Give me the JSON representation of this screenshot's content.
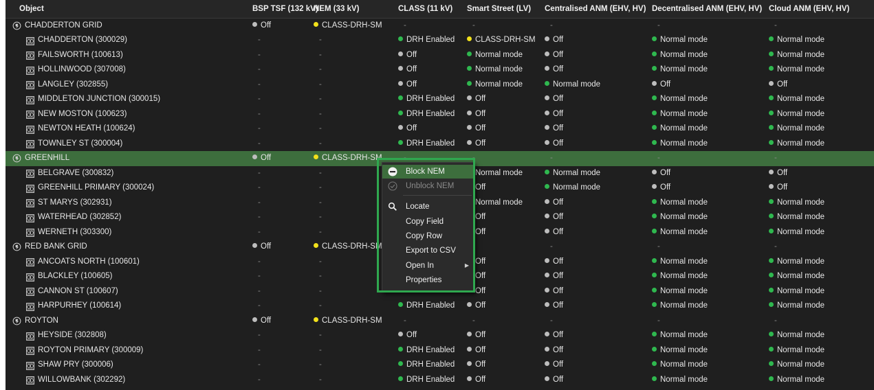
{
  "columns": [
    {
      "key": "object",
      "label": "Object"
    },
    {
      "key": "bsp",
      "label": "BSP TSF (132 kV)"
    },
    {
      "key": "nem",
      "label": "NEM (33 kV)"
    },
    {
      "key": "class11",
      "label": "CLASS (11 kV)"
    },
    {
      "key": "smart",
      "label": "Smart Street (LV)"
    },
    {
      "key": "central",
      "label": "Centralised ANM (EHV, HV)"
    },
    {
      "key": "decentral",
      "label": "Decentralised ANM (EHV, HV)"
    },
    {
      "key": "cloud",
      "label": "Cloud ANM (EHV, HV)"
    }
  ],
  "colors": {
    "green": "#2fb84f",
    "grey": "#bdbdbd",
    "yellow": "#f2e11b"
  },
  "rows": [
    {
      "name": "CHADDERTON GRID",
      "type": "grid",
      "cells": [
        {
          "c": "grey",
          "t": "Off"
        },
        {
          "c": "yellow",
          "t": "CLASS-DRH-SM"
        },
        {
          "t": "-"
        },
        {
          "t": "-"
        },
        {
          "t": "-"
        },
        {
          "t": "-"
        },
        {
          "t": "-"
        }
      ]
    },
    {
      "name": "CHADDERTON (300029)",
      "type": "sub",
      "cells": [
        {
          "t": "-"
        },
        {
          "t": "-"
        },
        {
          "c": "green",
          "t": "DRH Enabled"
        },
        {
          "c": "yellow",
          "t": "CLASS-DRH-SM"
        },
        {
          "c": "grey",
          "t": "Off"
        },
        {
          "c": "green",
          "t": "Normal mode"
        },
        {
          "c": "green",
          "t": "Normal mode"
        }
      ]
    },
    {
      "name": "FAILSWORTH (100613)",
      "type": "sub",
      "cells": [
        {
          "t": "-"
        },
        {
          "t": "-"
        },
        {
          "c": "grey",
          "t": "Off"
        },
        {
          "c": "green",
          "t": "Normal mode"
        },
        {
          "c": "grey",
          "t": "Off"
        },
        {
          "c": "green",
          "t": "Normal mode"
        },
        {
          "c": "green",
          "t": "Normal mode"
        }
      ]
    },
    {
      "name": "HOLLINWOOD (307008)",
      "type": "sub",
      "cells": [
        {
          "t": "-"
        },
        {
          "t": "-"
        },
        {
          "c": "grey",
          "t": "Off"
        },
        {
          "c": "green",
          "t": "Normal mode"
        },
        {
          "c": "grey",
          "t": "Off"
        },
        {
          "c": "green",
          "t": "Normal mode"
        },
        {
          "c": "green",
          "t": "Normal mode"
        }
      ]
    },
    {
      "name": "LANGLEY (302855)",
      "type": "sub",
      "cells": [
        {
          "t": "-"
        },
        {
          "t": "-"
        },
        {
          "c": "grey",
          "t": "Off"
        },
        {
          "c": "green",
          "t": "Normal mode"
        },
        {
          "c": "green",
          "t": "Normal mode"
        },
        {
          "c": "grey",
          "t": "Off"
        },
        {
          "c": "grey",
          "t": "Off"
        }
      ]
    },
    {
      "name": "MIDDLETON JUNCTION (300015)",
      "type": "sub",
      "cells": [
        {
          "t": "-"
        },
        {
          "t": "-"
        },
        {
          "c": "green",
          "t": "DRH Enabled"
        },
        {
          "c": "grey",
          "t": "Off"
        },
        {
          "c": "grey",
          "t": "Off"
        },
        {
          "c": "green",
          "t": "Normal mode"
        },
        {
          "c": "green",
          "t": "Normal mode"
        }
      ]
    },
    {
      "name": "NEW MOSTON (100623)",
      "type": "sub",
      "cells": [
        {
          "t": "-"
        },
        {
          "t": "-"
        },
        {
          "c": "green",
          "t": "DRH Enabled"
        },
        {
          "c": "grey",
          "t": "Off"
        },
        {
          "c": "grey",
          "t": "Off"
        },
        {
          "c": "green",
          "t": "Normal mode"
        },
        {
          "c": "green",
          "t": "Normal mode"
        }
      ]
    },
    {
      "name": "NEWTON HEATH (100624)",
      "type": "sub",
      "cells": [
        {
          "t": "-"
        },
        {
          "t": "-"
        },
        {
          "c": "grey",
          "t": "Off"
        },
        {
          "c": "grey",
          "t": "Off"
        },
        {
          "c": "grey",
          "t": "Off"
        },
        {
          "c": "green",
          "t": "Normal mode"
        },
        {
          "c": "green",
          "t": "Normal mode"
        }
      ]
    },
    {
      "name": "TOWNLEY ST (300004)",
      "type": "sub",
      "cells": [
        {
          "t": "-"
        },
        {
          "t": "-"
        },
        {
          "c": "green",
          "t": "DRH Enabled"
        },
        {
          "c": "grey",
          "t": "Off"
        },
        {
          "c": "grey",
          "t": "Off"
        },
        {
          "c": "green",
          "t": "Normal mode"
        },
        {
          "c": "green",
          "t": "Normal mode"
        }
      ]
    },
    {
      "name": "GREENHILL",
      "type": "grid",
      "selected": true,
      "cells": [
        {
          "c": "grey",
          "t": "Off"
        },
        {
          "c": "yellow",
          "t": "CLASS-DRH-SM"
        },
        {
          "t": "-"
        },
        {
          "t": "-"
        },
        {
          "t": "-"
        },
        {
          "t": "-"
        },
        {
          "t": "-"
        }
      ]
    },
    {
      "name": "BELGRAVE (300832)",
      "type": "sub",
      "cells": [
        {
          "t": "-"
        },
        {
          "t": "-"
        },
        {
          "t": ""
        },
        {
          "c": "green",
          "t": "Normal mode"
        },
        {
          "c": "green",
          "t": "Normal mode"
        },
        {
          "c": "grey",
          "t": "Off"
        },
        {
          "c": "grey",
          "t": "Off"
        }
      ]
    },
    {
      "name": "GREENHILL PRIMARY (300024)",
      "type": "sub",
      "cells": [
        {
          "t": "-"
        },
        {
          "t": "-"
        },
        {
          "t": ""
        },
        {
          "c": "grey",
          "t": "Off"
        },
        {
          "c": "green",
          "t": "Normal mode"
        },
        {
          "c": "grey",
          "t": "Off"
        },
        {
          "c": "grey",
          "t": "Off"
        }
      ]
    },
    {
      "name": "ST MARYS (302931)",
      "type": "sub",
      "cells": [
        {
          "t": "-"
        },
        {
          "t": "-"
        },
        {
          "t": ""
        },
        {
          "c": "green",
          "t": "Normal mode"
        },
        {
          "c": "grey",
          "t": "Off"
        },
        {
          "c": "green",
          "t": "Normal mode"
        },
        {
          "c": "green",
          "t": "Normal mode"
        }
      ]
    },
    {
      "name": "WATERHEAD (302852)",
      "type": "sub",
      "cells": [
        {
          "t": "-"
        },
        {
          "t": "-"
        },
        {
          "t": ""
        },
        {
          "c": "grey",
          "t": "Off"
        },
        {
          "c": "grey",
          "t": "Off"
        },
        {
          "c": "green",
          "t": "Normal mode"
        },
        {
          "c": "green",
          "t": "Normal mode"
        }
      ]
    },
    {
      "name": "WERNETH (303300)",
      "type": "sub",
      "cells": [
        {
          "t": "-"
        },
        {
          "t": "-"
        },
        {
          "t": ""
        },
        {
          "c": "grey",
          "t": "Off"
        },
        {
          "c": "grey",
          "t": "Off"
        },
        {
          "c": "green",
          "t": "Normal mode"
        },
        {
          "c": "green",
          "t": "Normal mode"
        }
      ]
    },
    {
      "name": "RED BANK GRID",
      "type": "grid",
      "cells": [
        {
          "c": "grey",
          "t": "Off"
        },
        {
          "c": "yellow",
          "t": "CLASS-DRH-SM"
        },
        {
          "t": ""
        },
        {
          "t": "-"
        },
        {
          "t": "-"
        },
        {
          "t": "-"
        },
        {
          "t": "-"
        }
      ]
    },
    {
      "name": "ANCOATS NORTH (100601)",
      "type": "sub",
      "cells": [
        {
          "t": "-"
        },
        {
          "t": "-"
        },
        {
          "t": ""
        },
        {
          "c": "grey",
          "t": "Off"
        },
        {
          "c": "grey",
          "t": "Off"
        },
        {
          "c": "green",
          "t": "Normal mode"
        },
        {
          "c": "green",
          "t": "Normal mode"
        }
      ]
    },
    {
      "name": "BLACKLEY (100605)",
      "type": "sub",
      "cells": [
        {
          "t": "-"
        },
        {
          "t": "-"
        },
        {
          "t": ""
        },
        {
          "c": "grey",
          "t": "Off"
        },
        {
          "c": "grey",
          "t": "Off"
        },
        {
          "c": "green",
          "t": "Normal mode"
        },
        {
          "c": "green",
          "t": "Normal mode"
        }
      ]
    },
    {
      "name": "CANNON ST (100607)",
      "type": "sub",
      "cells": [
        {
          "t": "-"
        },
        {
          "t": "-"
        },
        {
          "t": ""
        },
        {
          "c": "grey",
          "t": "Off"
        },
        {
          "c": "grey",
          "t": "Off"
        },
        {
          "c": "green",
          "t": "Normal mode"
        },
        {
          "c": "green",
          "t": "Normal mode"
        }
      ]
    },
    {
      "name": "HARPURHEY (100614)",
      "type": "sub",
      "cells": [
        {
          "t": "-"
        },
        {
          "t": "-"
        },
        {
          "c": "green",
          "t": "DRH Enabled"
        },
        {
          "c": "grey",
          "t": "Off"
        },
        {
          "c": "grey",
          "t": "Off"
        },
        {
          "c": "green",
          "t": "Normal mode"
        },
        {
          "c": "green",
          "t": "Normal mode"
        }
      ]
    },
    {
      "name": "ROYTON",
      "type": "grid",
      "cells": [
        {
          "c": "grey",
          "t": "Off"
        },
        {
          "c": "yellow",
          "t": "CLASS-DRH-SM"
        },
        {
          "t": "-"
        },
        {
          "t": "-"
        },
        {
          "t": "-"
        },
        {
          "t": "-"
        },
        {
          "t": "-"
        }
      ]
    },
    {
      "name": "HEYSIDE (302808)",
      "type": "sub",
      "cells": [
        {
          "t": "-"
        },
        {
          "t": "-"
        },
        {
          "c": "grey",
          "t": "Off"
        },
        {
          "c": "grey",
          "t": "Off"
        },
        {
          "c": "grey",
          "t": "Off"
        },
        {
          "c": "green",
          "t": "Normal mode"
        },
        {
          "c": "green",
          "t": "Normal mode"
        }
      ]
    },
    {
      "name": "ROYTON PRIMARY (300009)",
      "type": "sub",
      "cells": [
        {
          "t": "-"
        },
        {
          "t": "-"
        },
        {
          "c": "green",
          "t": "DRH Enabled"
        },
        {
          "c": "grey",
          "t": "Off"
        },
        {
          "c": "grey",
          "t": "Off"
        },
        {
          "c": "green",
          "t": "Normal mode"
        },
        {
          "c": "green",
          "t": "Normal mode"
        }
      ]
    },
    {
      "name": "SHAW PRY (300006)",
      "type": "sub",
      "cells": [
        {
          "t": "-"
        },
        {
          "t": "-"
        },
        {
          "c": "green",
          "t": "DRH Enabled"
        },
        {
          "c": "grey",
          "t": "Off"
        },
        {
          "c": "grey",
          "t": "Off"
        },
        {
          "c": "green",
          "t": "Normal mode"
        },
        {
          "c": "green",
          "t": "Normal mode"
        }
      ]
    },
    {
      "name": "WILLOWBANK (302292)",
      "type": "sub",
      "cells": [
        {
          "t": "-"
        },
        {
          "t": "-"
        },
        {
          "c": "green",
          "t": "DRH Enabled"
        },
        {
          "c": "grey",
          "t": "Off"
        },
        {
          "c": "grey",
          "t": "Off"
        },
        {
          "c": "green",
          "t": "Normal mode"
        },
        {
          "c": "green",
          "t": "Normal mode"
        }
      ]
    }
  ],
  "context_menu": {
    "items": [
      {
        "label": "Block NEM",
        "icon": "block-icon",
        "active": true
      },
      {
        "label": "Unblock NEM",
        "icon": "check-circle-icon",
        "disabled": true
      },
      {
        "label": "Locate",
        "icon": "search-icon"
      },
      {
        "label": "Copy Field"
      },
      {
        "label": "Copy Row"
      },
      {
        "label": "Export to CSV"
      },
      {
        "label": "Open In",
        "submenu": true
      },
      {
        "label": "Properties"
      }
    ]
  }
}
